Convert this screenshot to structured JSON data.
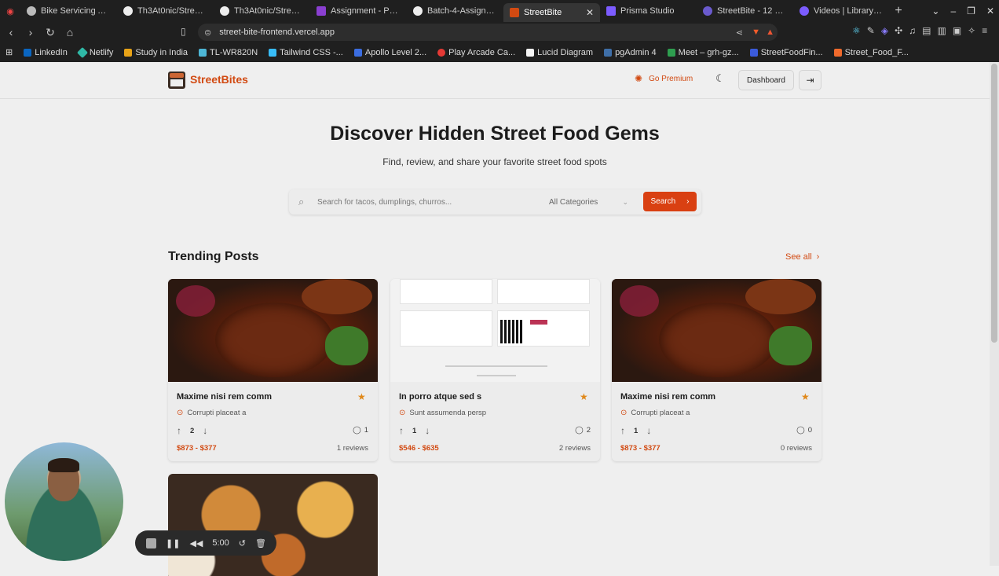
{
  "browser": {
    "tabs": [
      {
        "label": "Bike Servicing API S",
        "icon_color": "#bbbbbb",
        "active": false
      },
      {
        "label": "Th3At0nic/Street-F",
        "icon_color": "#eeeeee",
        "active": false
      },
      {
        "label": "Th3At0nic/Street-F",
        "icon_color": "#eeeeee",
        "active": false
      },
      {
        "label": "Assignment - Progr",
        "icon_color": "#8a3fd1",
        "active": false
      },
      {
        "label": "Batch-4-Assignmen",
        "icon_color": "#eeeeee",
        "active": false
      },
      {
        "label": "StreetBite",
        "icon_color": "#d24a12",
        "active": true
      },
      {
        "label": "Prisma Studio",
        "icon_color": "#7c5cff",
        "active": false
      },
      {
        "label": "StreetBite - 12 May",
        "icon_color": "#6a5acd",
        "active": false
      },
      {
        "label": "Videos | Library | Lo",
        "icon_color": "#7b5cff",
        "active": false
      }
    ],
    "url": "street-bite-frontend.vercel.app",
    "bookmarks": [
      {
        "label": "LinkedIn",
        "icon_color": "#0a66c2"
      },
      {
        "label": "Netlify",
        "icon_color": "#2fb8a6"
      },
      {
        "label": "Study in India",
        "icon_color": "#e8a317"
      },
      {
        "label": "TL-WR820N",
        "icon_color": "#4db6d6"
      },
      {
        "label": "Tailwind CSS -...",
        "icon_color": "#38bdf8"
      },
      {
        "label": "Apollo Level 2...",
        "icon_color": "#3b6de0"
      },
      {
        "label": "Play Arcade Ca...",
        "icon_color": "#e53935"
      },
      {
        "label": "Lucid Diagram",
        "icon_color": "#f5f5f5"
      },
      {
        "label": "pgAdmin 4",
        "icon_color": "#3f6fa8"
      },
      {
        "label": "Meet – grh-gz...",
        "icon_color": "#2e9e4f"
      },
      {
        "label": "StreetFoodFin...",
        "icon_color": "#3b5bdb"
      },
      {
        "label": "Street_Food_F...",
        "icon_color": "#f06a2c"
      }
    ]
  },
  "header": {
    "brand": "StreetBites",
    "premium_label": "Go Premium",
    "dashboard_label": "Dashboard"
  },
  "hero": {
    "title": "Discover Hidden Street Food Gems",
    "subtitle": "Find, review, and share your favorite street food spots"
  },
  "search": {
    "placeholder": "Search for tacos, dumplings, churros...",
    "category": "All Categories",
    "button_label": "Search"
  },
  "trending": {
    "title": "Trending Posts",
    "see_all": "See all",
    "posts": [
      {
        "title": "Maxime nisi rem comm",
        "location": "Corrupti placeat a",
        "votes": "2",
        "comments": "1",
        "price": "$873 - $377",
        "reviews": "1 reviews",
        "image": "chicken"
      },
      {
        "title": "In porro atque sed s",
        "location": "Sunt assumenda persp",
        "votes": "1",
        "comments": "2",
        "price": "$546 - $635",
        "reviews": "2 reviews",
        "image": "document"
      },
      {
        "title": "Maxime nisi rem comm",
        "location": "Corrupti placeat a",
        "votes": "1",
        "comments": "0",
        "price": "$873 - $377",
        "reviews": "0 reviews",
        "image": "chicken"
      }
    ]
  },
  "recorder": {
    "time": "5:00"
  },
  "colors": {
    "accent": "#d24a12",
    "button": "#d94012",
    "star": "#e0881a"
  }
}
